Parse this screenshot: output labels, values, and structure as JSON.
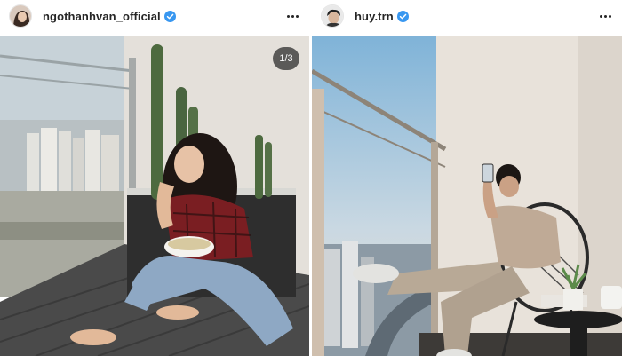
{
  "posts": [
    {
      "username": "ngothanhvan_official",
      "verified": true,
      "media_counter": "1/3",
      "more_icon": "more-horizontal-icon",
      "photo": "woman-eating-on-balcony"
    },
    {
      "username": "huy.trn",
      "verified": true,
      "more_icon": "more-horizontal-icon",
      "photo": "man-phone-on-balcony-chair"
    }
  ],
  "colors": {
    "verified_blue": "#3897f0",
    "text": "#262626",
    "badge_bg": "#262626"
  }
}
